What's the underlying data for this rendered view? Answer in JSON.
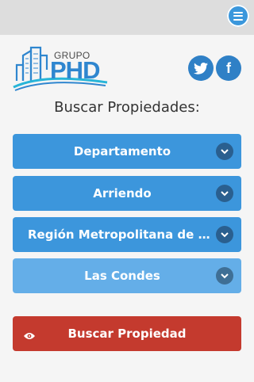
{
  "header": {
    "menu_icon": "hamburger-menu-icon"
  },
  "brand": {
    "grupo": "GRUPO",
    "phd": "PHD"
  },
  "social": {
    "twitter_icon": "twitter-icon",
    "facebook_icon": "facebook-icon",
    "facebook_glyph": "f"
  },
  "search": {
    "heading": "Buscar Propiedades:",
    "property_type": "Departamento",
    "operation": "Arriendo",
    "region": "Región Metropolitana de Santiago",
    "commune": "Las Condes",
    "button_label": "Buscar Propiedad"
  },
  "colors": {
    "primary_blue": "#3c96dc",
    "light_blue": "#64aee8",
    "button_red": "#c43a2e",
    "social_blue": "#2f80c6"
  }
}
